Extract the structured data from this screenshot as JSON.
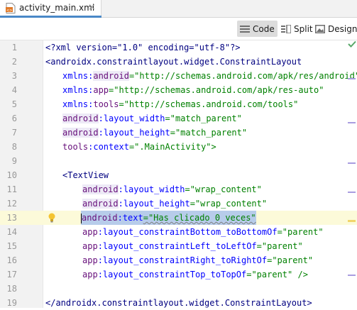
{
  "tab": {
    "filename": "activity_main.xml",
    "close_glyph": "×"
  },
  "toolbar": {
    "code_label": "Code",
    "split_label": "Split",
    "design_label": "Design"
  },
  "colors": {
    "accent": "#4a88c7",
    "selection": "#b7ccea",
    "current_line": "#fcfad9",
    "tag": "#000080",
    "namespace": "#660e7a",
    "attribute": "#0000ff",
    "value": "#008000"
  },
  "icons": {
    "file": "xml-file-icon",
    "code": "code-view-icon",
    "split": "split-view-icon",
    "design": "design-view-icon",
    "intention": "lightbulb-icon"
  },
  "lines": [
    {
      "n": "1",
      "t": "<?xml version=\"1.0\" encoding=\"utf-8\"?>"
    },
    {
      "n": "2",
      "t": "<androidx.constraintlayout.widget.ConstraintLayout"
    },
    {
      "n": "3",
      "ns": "xmlns:",
      "name": "android",
      "rest": "=\"http://schemas.android.com/apk/res/android\""
    },
    {
      "n": "4",
      "ns": "xmlns:",
      "name": "app",
      "rest": "=\"http://schemas.android.com/apk/res-auto\""
    },
    {
      "n": "5",
      "ns": "xmlns:",
      "name": "tools",
      "rest": "=\"http://schemas.android.com/tools\""
    },
    {
      "n": "6",
      "ns": "android",
      ":": ":",
      "name": "layout_width",
      "rest": "=\"match_parent\""
    },
    {
      "n": "7",
      "ns": "android",
      "name": "layout_height",
      "rest": "=\"match_parent\""
    },
    {
      "n": "8",
      "ns": "tools",
      "name": "context",
      "rest": "=\".MainActivity\">"
    },
    {
      "n": "9",
      "t": ""
    },
    {
      "n": "10",
      "t": "<TextView"
    },
    {
      "n": "11",
      "ns": "android",
      "name": "layout_width",
      "rest": "=\"wrap_content\""
    },
    {
      "n": "12",
      "ns": "android",
      "name": "layout_height",
      "rest": "=\"wrap_content\""
    },
    {
      "n": "13",
      "ns": "android",
      "name": "text",
      "rest": "=\"Has clicado 0 veces\""
    },
    {
      "n": "14",
      "ns": "app",
      "name": "layout_constraintBottom_toBottomOf",
      "rest": "=\"parent\""
    },
    {
      "n": "15",
      "ns": "app",
      "name": "layout_constraintLeft_toLeftOf",
      "rest": "=\"parent\""
    },
    {
      "n": "16",
      "ns": "app",
      "name": "layout_constraintRight_toRightOf",
      "rest": "=\"parent\""
    },
    {
      "n": "17",
      "ns": "app",
      "name": "layout_constraintTop_toTopOf",
      "rest": "=\"parent\" />"
    },
    {
      "n": "18",
      "t": ""
    },
    {
      "n": "19",
      "t": "</androidx.constraintlayout.widget.ConstraintLayout>"
    },
    {
      "n": "20",
      "t": ""
    }
  ]
}
